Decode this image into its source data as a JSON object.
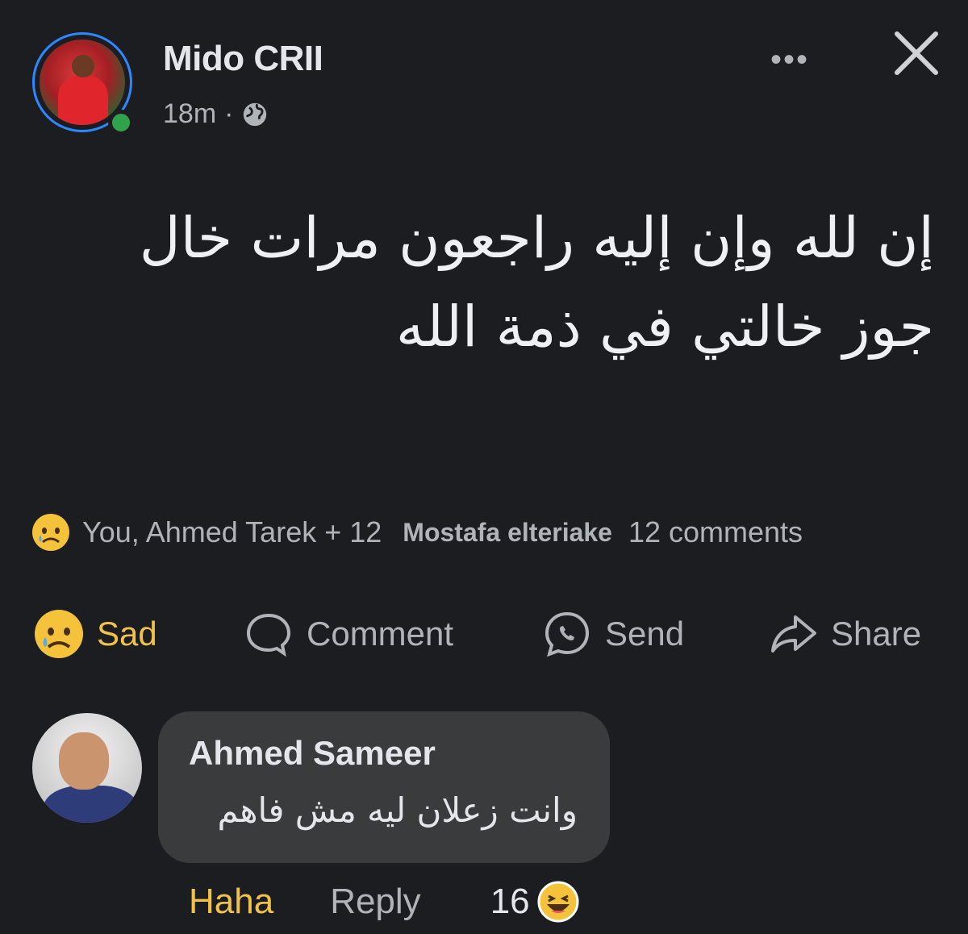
{
  "post": {
    "author": "Mido CRII",
    "time": "18m",
    "separator": "·",
    "more_label": "•••",
    "text_lines": [
      "إن لله وإن إليه راجعون مرات خال",
      "جوز خالتي في ذمة الله"
    ]
  },
  "summary": {
    "reactors": "You, Ahmed Tarek + 12",
    "top_commenter": "Mostafa elteriake",
    "comments": "12 comments"
  },
  "actions": {
    "reaction_label": "Sad",
    "comment_label": "Comment",
    "send_label": "Send",
    "share_label": "Share"
  },
  "comment": {
    "author": "Ahmed Sameer",
    "text": "وانت زعلان ليه مش فاهم",
    "haha_label": "Haha",
    "reply_label": "Reply",
    "reaction_count": "16"
  },
  "icons": {
    "globe": "globe-icon",
    "close": "close-icon",
    "sad": "sad-emoji-icon",
    "comment": "comment-bubble-icon",
    "send": "messenger-icon",
    "share": "share-arrow-icon",
    "haha": "haha-emoji-icon"
  },
  "colors": {
    "background": "#1c1d21",
    "text_primary": "#e4e6eb",
    "text_secondary": "#b0b3b8",
    "sad_accent": "#f0c24a",
    "online": "#31a24c",
    "story_ring": "#2d88ff",
    "bubble": "#3a3b3c"
  }
}
